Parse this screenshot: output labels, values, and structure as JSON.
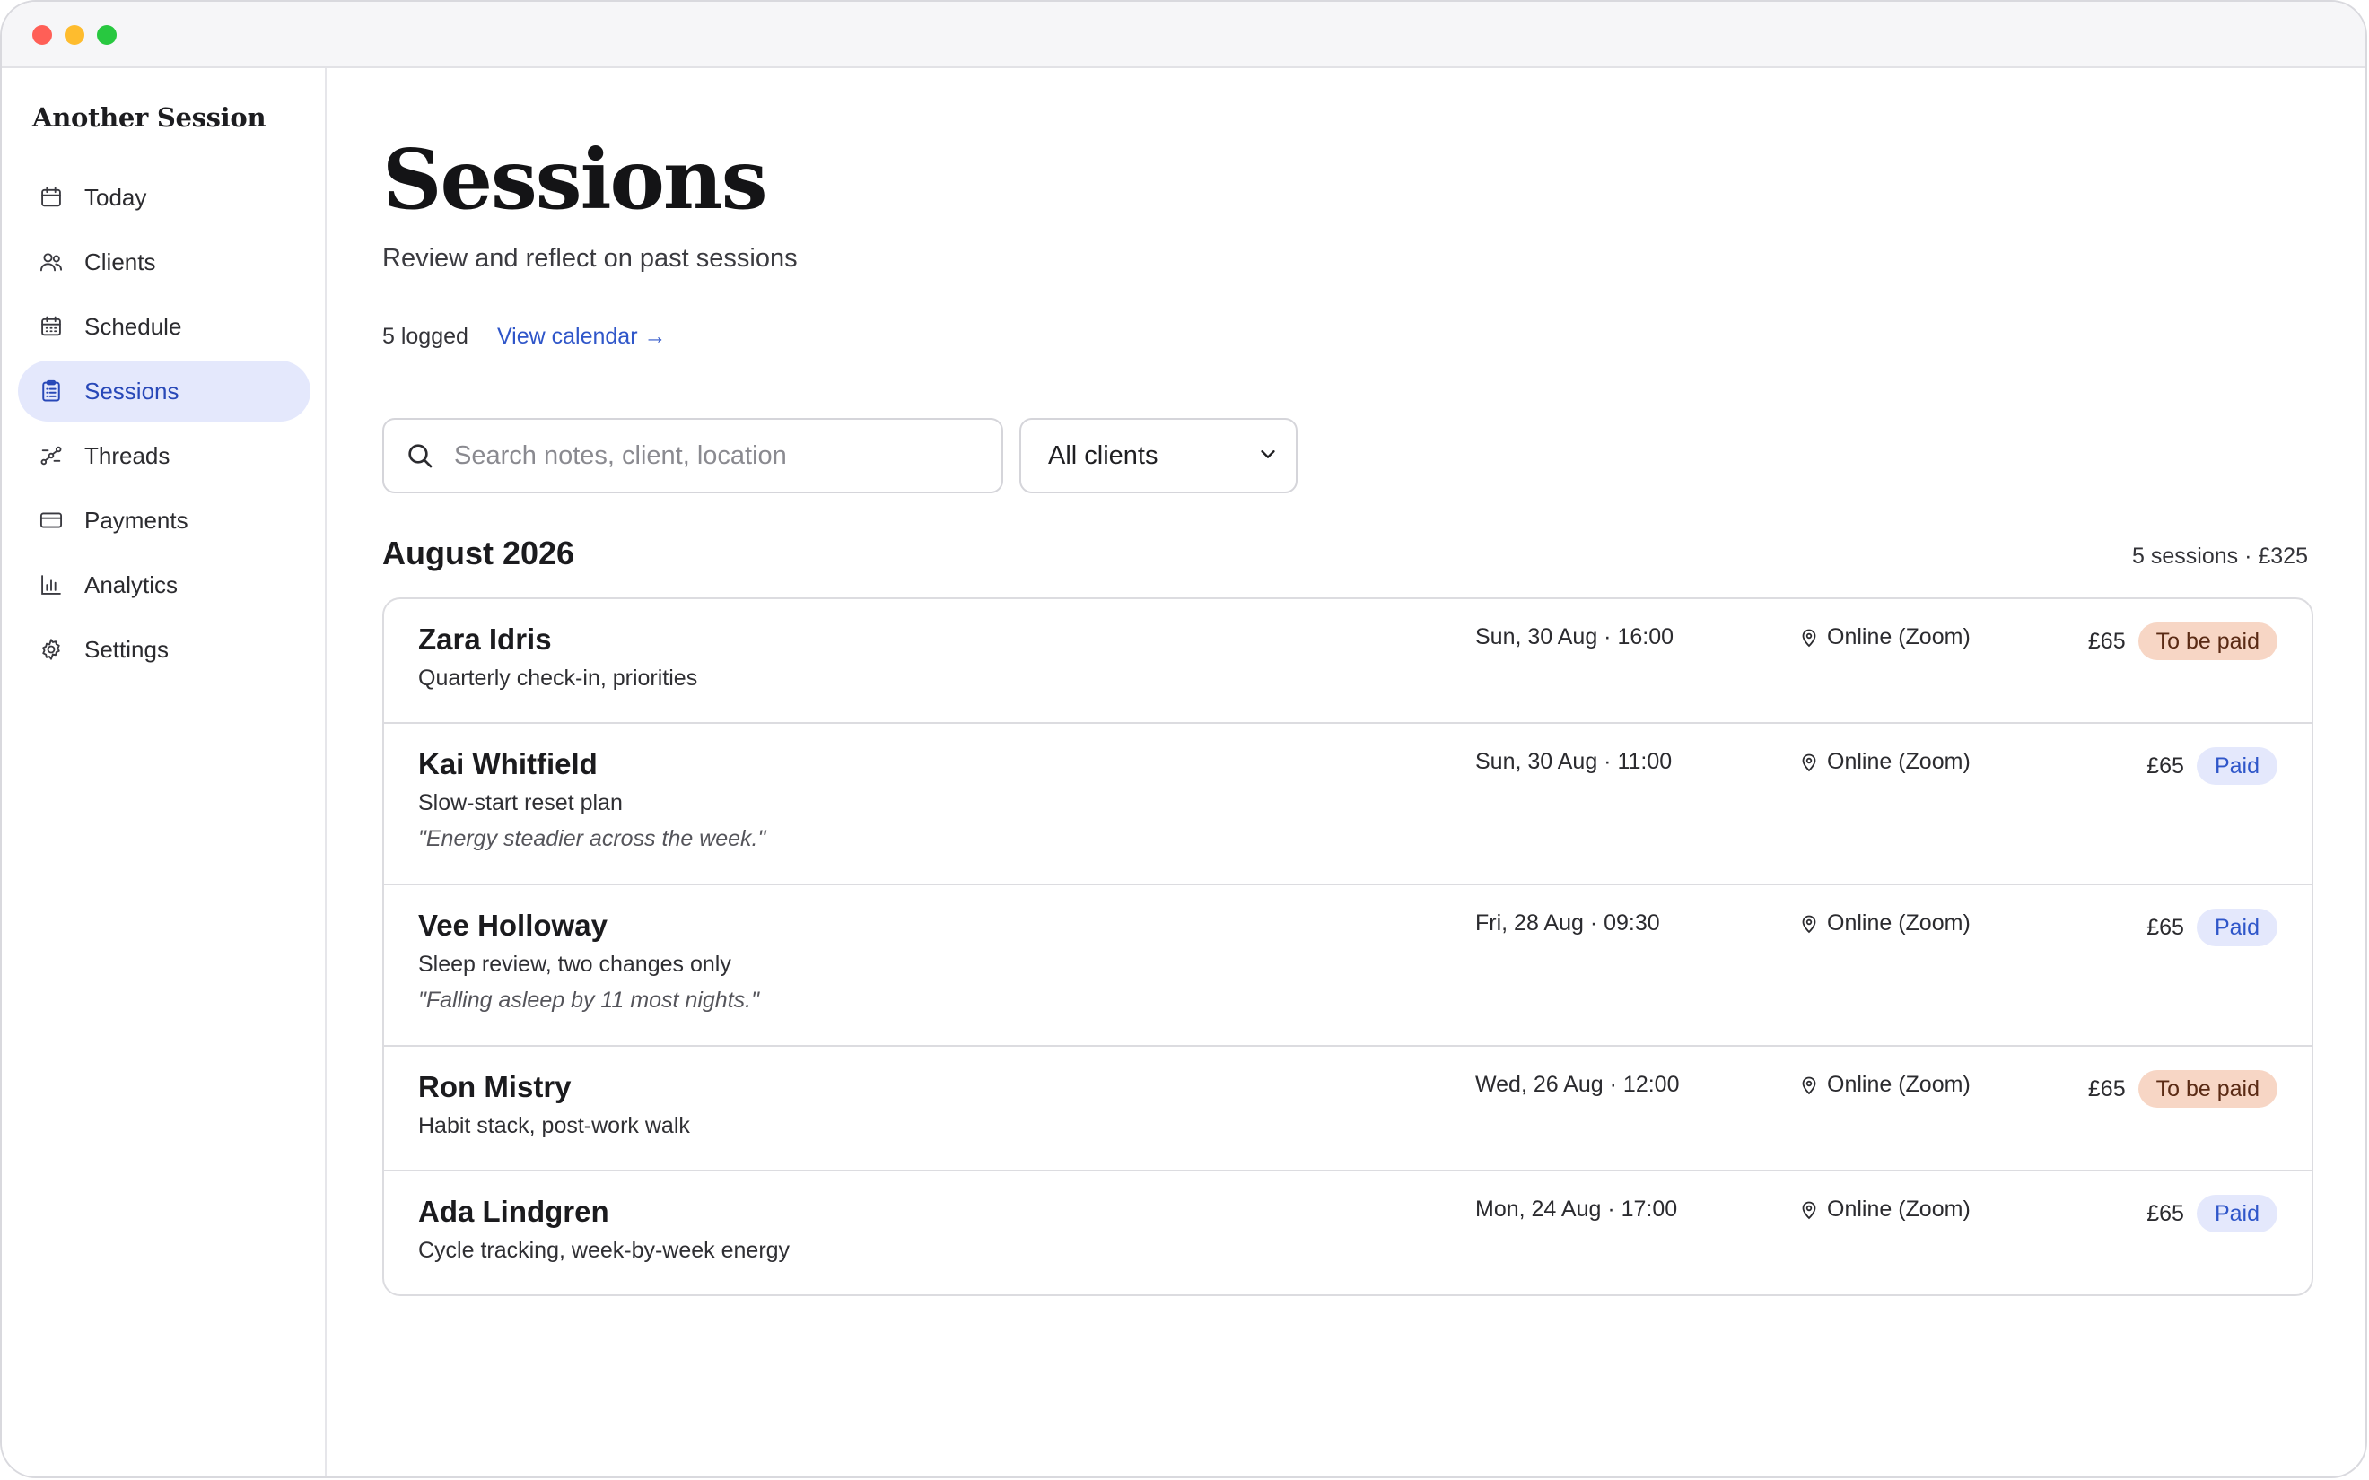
{
  "app": {
    "brand": "Another Session"
  },
  "nav": {
    "items": [
      {
        "label": "Today",
        "icon": "calendar-icon"
      },
      {
        "label": "Clients",
        "icon": "users-icon"
      },
      {
        "label": "Schedule",
        "icon": "calendar-grid-icon"
      },
      {
        "label": "Sessions",
        "icon": "clipboard-icon",
        "active": true
      },
      {
        "label": "Threads",
        "icon": "threads-icon"
      },
      {
        "label": "Payments",
        "icon": "credit-card-icon"
      },
      {
        "label": "Analytics",
        "icon": "bar-chart-icon"
      },
      {
        "label": "Settings",
        "icon": "gear-icon"
      }
    ]
  },
  "page": {
    "title": "Sessions",
    "subtitle": "Review and reflect on past sessions",
    "logged": "5 logged",
    "view_calendar": "View calendar →"
  },
  "filters": {
    "search_placeholder": "Search notes, client, location",
    "client_select": "All clients"
  },
  "group": {
    "month": "August 2026",
    "summary": "5 sessions · £325"
  },
  "sessions": [
    {
      "client": "Zara Idris",
      "topic": "Quarterly check-in, priorities",
      "quote": "",
      "date": "Sun, 30 Aug · 16:00",
      "location": "Online (Zoom)",
      "amount": "£65",
      "status": "To be paid"
    },
    {
      "client": "Kai Whitfield",
      "topic": "Slow-start reset plan",
      "quote": "\"Energy steadier across the week.\"",
      "date": "Sun, 30 Aug · 11:00",
      "location": "Online (Zoom)",
      "amount": "£65",
      "status": "Paid"
    },
    {
      "client": "Vee Holloway",
      "topic": "Sleep review, two changes only",
      "quote": "\"Falling asleep by 11 most nights.\"",
      "date": "Fri, 28 Aug · 09:30",
      "location": "Online (Zoom)",
      "amount": "£65",
      "status": "Paid"
    },
    {
      "client": "Ron Mistry",
      "topic": "Habit stack, post-work walk",
      "quote": "",
      "date": "Wed, 26 Aug · 12:00",
      "location": "Online (Zoom)",
      "amount": "£65",
      "status": "To be paid"
    },
    {
      "client": "Ada Lindgren",
      "topic": "Cycle tracking, week-by-week energy",
      "quote": "",
      "date": "Mon, 24 Aug · 17:00",
      "location": "Online (Zoom)",
      "amount": "£65",
      "status": "Paid"
    }
  ],
  "colors": {
    "accent": "#2f56c9",
    "active_bg": "#e4e8fc",
    "unpaid_bg": "#f7d6c5",
    "paid_bg": "#e4e8fc"
  }
}
